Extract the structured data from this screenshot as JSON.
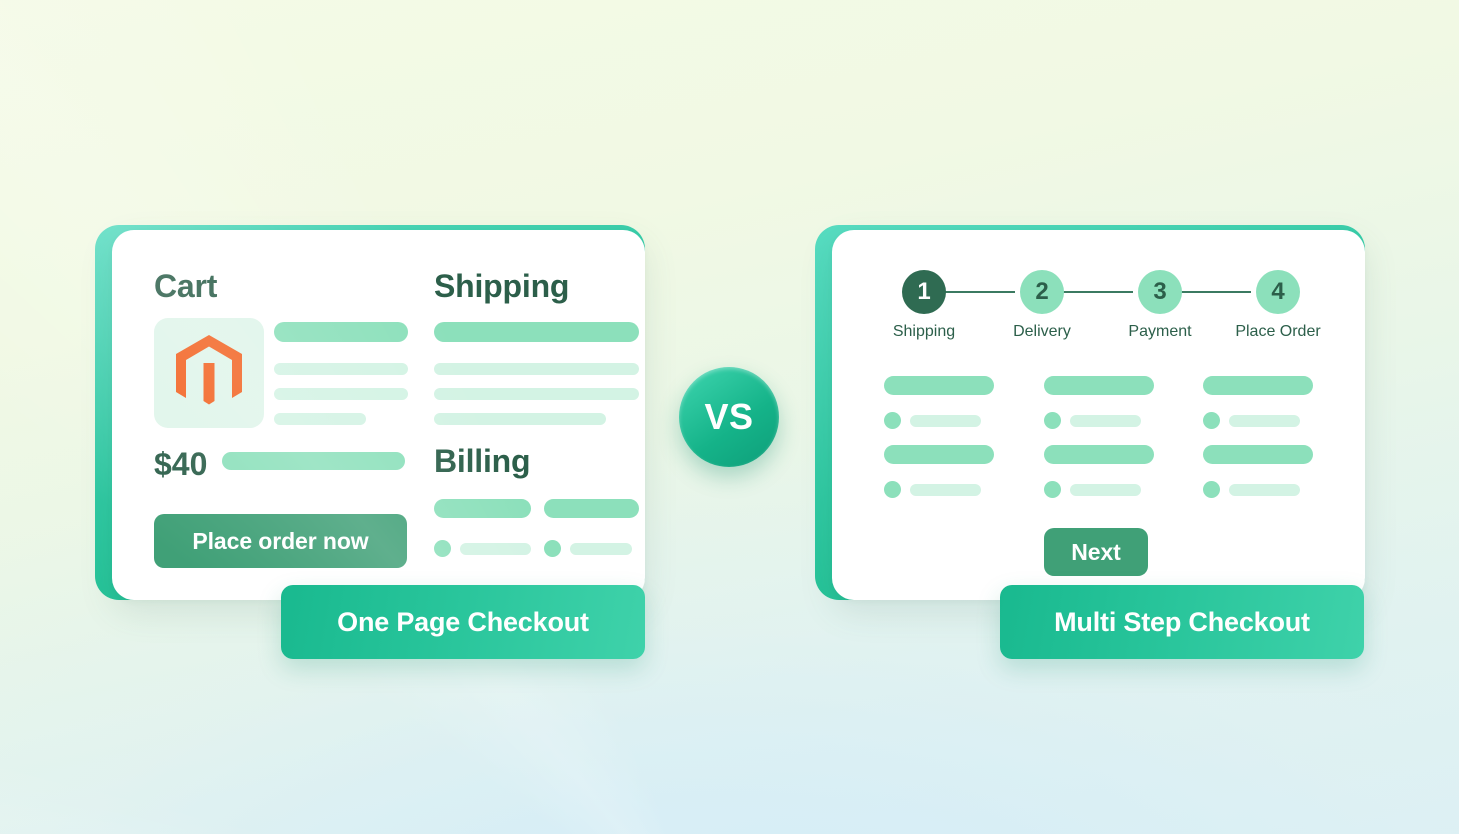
{
  "theme": {
    "accent_dark": "#2c5f4a",
    "accent_green": "#40a077",
    "accent_teal": "#12b886",
    "skeleton_strong": "#8ce0bb",
    "skeleton_faint": "#d3f3e4",
    "magento_orange": "#f26322"
  },
  "vs_badge": {
    "label": "VS"
  },
  "one_page": {
    "ribbon_label": "One Page Checkout",
    "cart_heading": "Cart",
    "shipping_heading": "Shipping",
    "billing_heading": "Billing",
    "price": "$40",
    "cta_label": "Place order now",
    "logo_name": "magento-logo"
  },
  "multi_step": {
    "ribbon_label": "Multi Step Checkout",
    "cta_label": "Next",
    "steps": [
      {
        "number": "1",
        "label": "Shipping",
        "active": true
      },
      {
        "number": "2",
        "label": "Delivery",
        "active": false
      },
      {
        "number": "3",
        "label": "Payment",
        "active": false
      },
      {
        "number": "4",
        "label": "Place Order",
        "active": false
      }
    ]
  }
}
